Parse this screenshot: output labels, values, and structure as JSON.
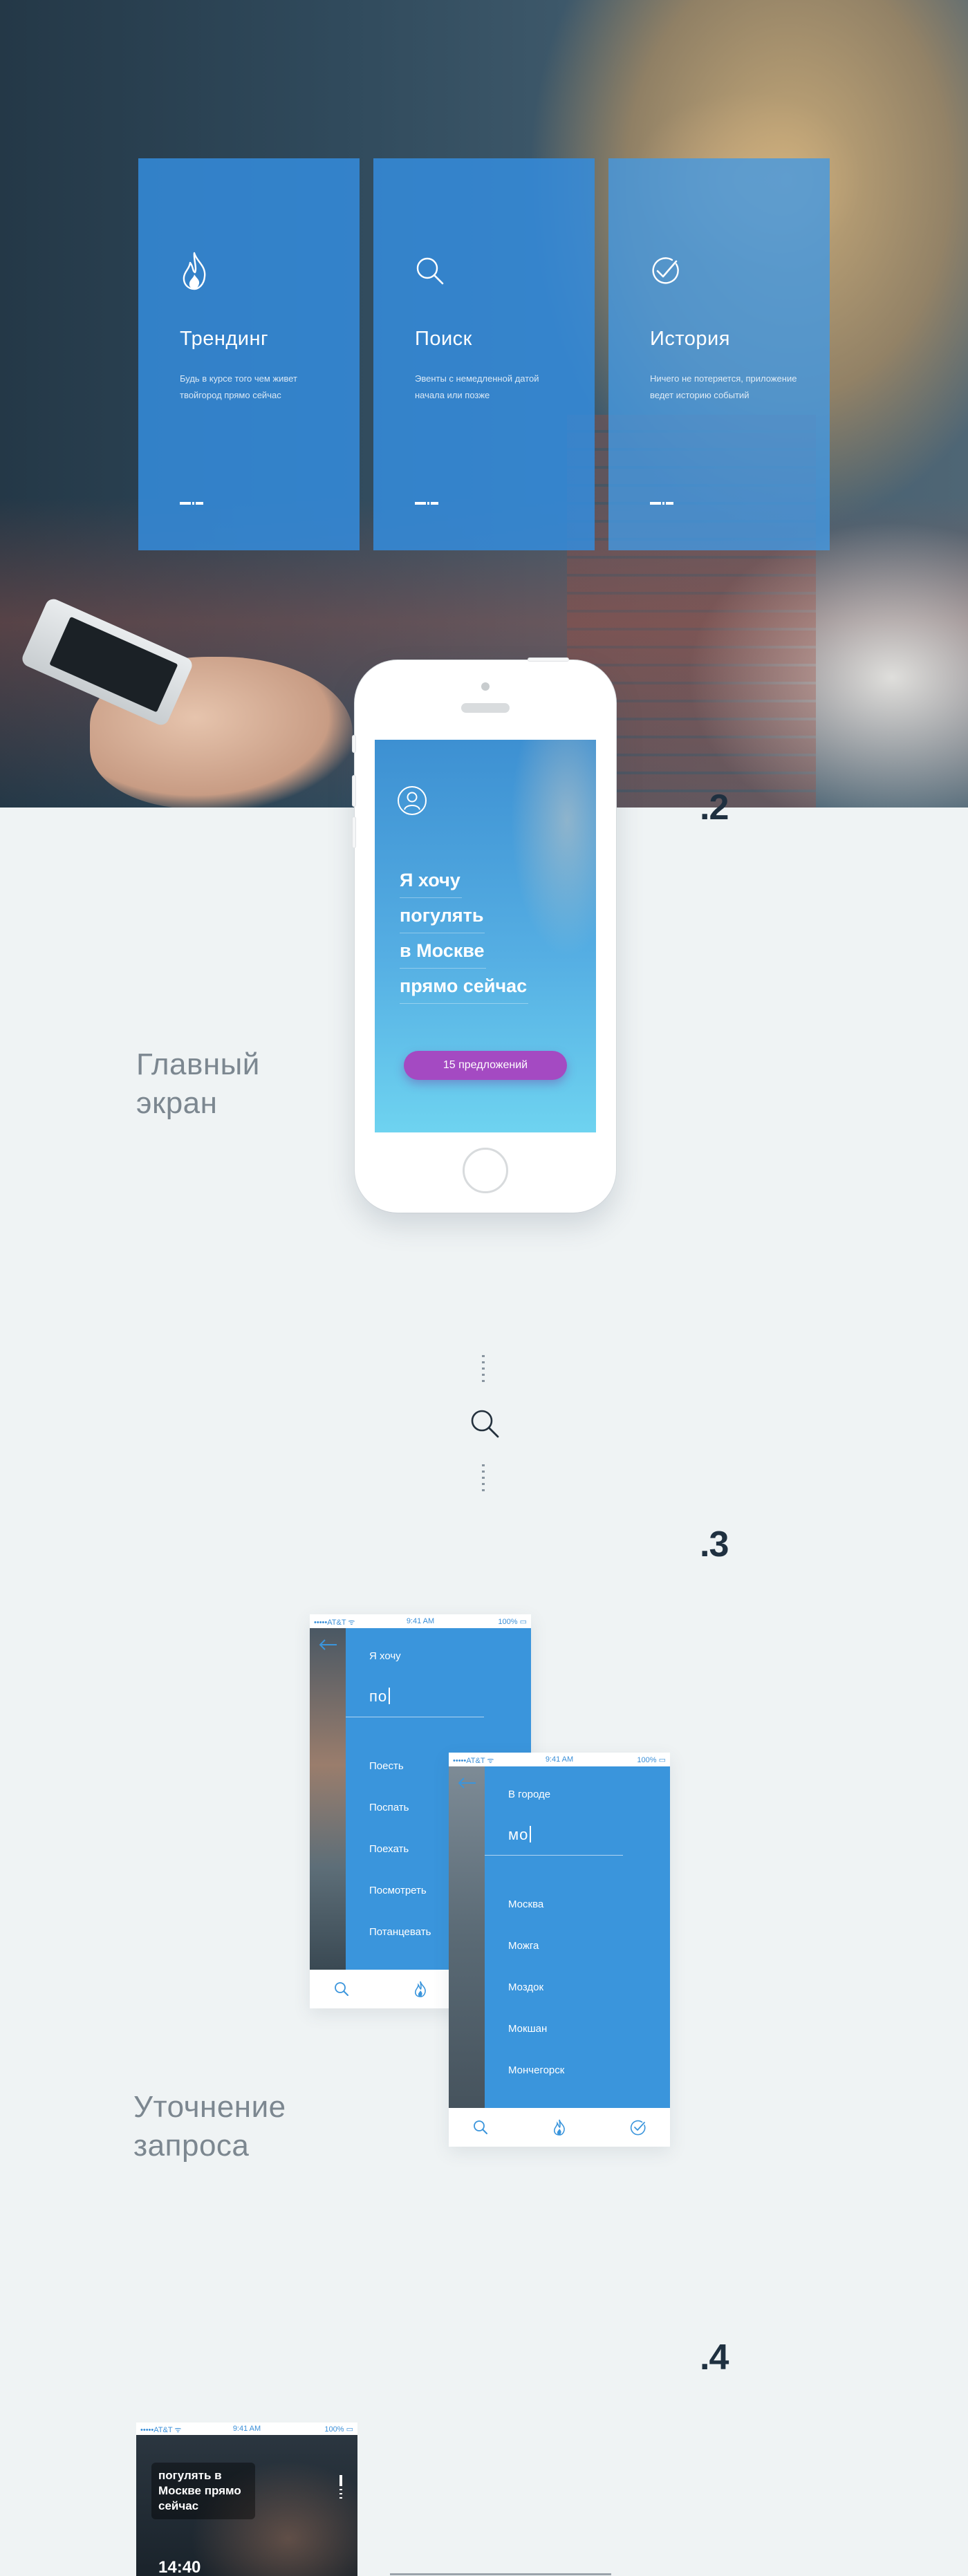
{
  "hero": {
    "cards": [
      {
        "icon": "flame-icon",
        "title": "Трендинг",
        "desc": "Будь в курсе того чем живет твойгород прямо сейчас"
      },
      {
        "icon": "search-icon",
        "title": "Поиск",
        "desc": "Эвенты с немедленной датой начала или позже"
      },
      {
        "icon": "check-circle-icon",
        "title": "История",
        "desc": "Ничего не потеряется, приложение ведет историю событий"
      }
    ]
  },
  "section2": {
    "number": ".2",
    "label_line1": "Главный",
    "label_line2": "экран",
    "phone": {
      "headline": [
        "Я хочу",
        "погулять",
        "в Москве",
        "прямо сейчас"
      ],
      "cta": "15 предложений"
    }
  },
  "section3": {
    "number": ".3",
    "label_line1": "Уточнение",
    "label_line2": "запроса",
    "screen1": {
      "status": {
        "carrier": "•••••AT&T ᯤ",
        "time": "9:41 AM",
        "battery": "100% ▭"
      },
      "prompt": "Я хочу",
      "query": "по",
      "options": [
        "Поесть",
        "Поспать",
        "Поехать",
        "Посмотреть",
        "Потанцевать"
      ]
    },
    "screen2": {
      "status": {
        "carrier": "•••••AT&T ᯤ",
        "time": "9:41 AM",
        "battery": "100% ▭"
      },
      "prompt": "В городе",
      "query": "мо",
      "options": [
        "Москва",
        "Можга",
        "Моздок",
        "Мокшан",
        "Мончегорск"
      ]
    }
  },
  "section4": {
    "number": ".4",
    "screen": {
      "status": {
        "carrier": "•••••AT&T ᯤ",
        "time": "9:41 AM",
        "battery": "100% ▭"
      },
      "tag": "погулять в Москве прямо сейчас",
      "time": "14:40"
    }
  },
  "colors": {
    "accent": "#3a95dc",
    "cta": "#a44ac2",
    "text_dark": "#1f3040",
    "text_muted": "#7c8790"
  }
}
